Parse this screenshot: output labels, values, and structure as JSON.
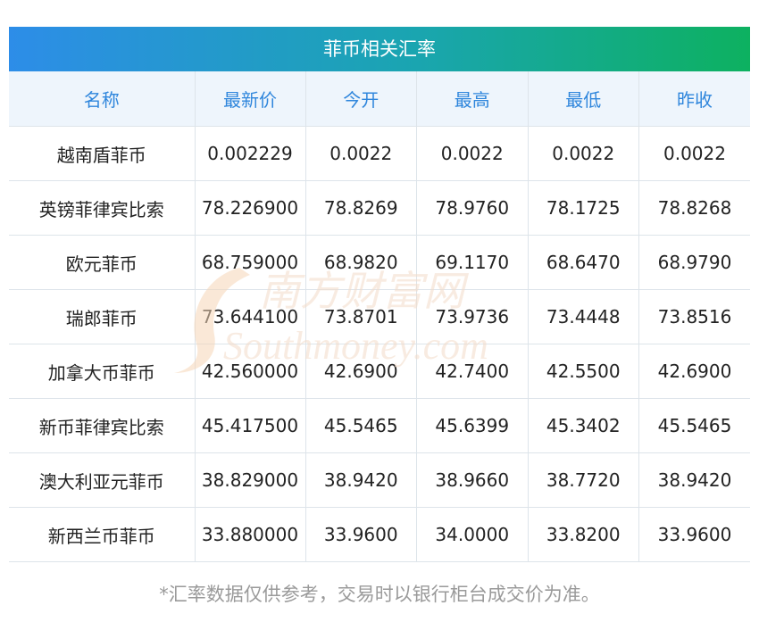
{
  "title": "菲币相关汇率",
  "headers": [
    "名称",
    "最新价",
    "今开",
    "最高",
    "最低",
    "昨收"
  ],
  "rows": [
    [
      "越南盾菲币",
      "0.002229",
      "0.0022",
      "0.0022",
      "0.0022",
      "0.0022"
    ],
    [
      "英镑菲律宾比索",
      "78.226900",
      "78.8269",
      "78.9760",
      "78.1725",
      "78.8268"
    ],
    [
      "欧元菲币",
      "68.759000",
      "68.9820",
      "69.1170",
      "68.6470",
      "68.9790"
    ],
    [
      "瑞郎菲币",
      "73.644100",
      "73.8701",
      "73.9736",
      "73.4448",
      "73.8516"
    ],
    [
      "加拿大币菲币",
      "42.560000",
      "42.6900",
      "42.7400",
      "42.5500",
      "42.6900"
    ],
    [
      "新币菲律宾比索",
      "45.417500",
      "45.5465",
      "45.6399",
      "45.3402",
      "45.5465"
    ],
    [
      "澳大利亚元菲币",
      "38.829000",
      "38.9420",
      "38.9660",
      "38.7720",
      "38.9420"
    ],
    [
      "新西兰币菲币",
      "33.880000",
      "33.9600",
      "34.0000",
      "33.8200",
      "33.9600"
    ]
  ],
  "footnote": "*汇率数据仅供参考，交易时以银行柜台成交价为准。",
  "watermark": {
    "cn": "南方财富网",
    "en": "Southmoney.com"
  },
  "colors": {
    "header_text": "#2f86dc",
    "title_start": "#2d8de8",
    "title_end": "#0db160"
  }
}
